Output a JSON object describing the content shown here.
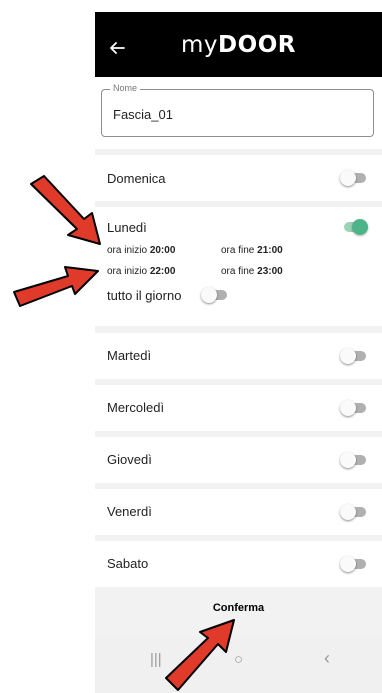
{
  "app": {
    "logo_my": "my",
    "logo_door": "DOOR",
    "back_icon": "arrow-left-icon"
  },
  "name_field": {
    "label": "Nome",
    "value": "Fascia_01"
  },
  "days": [
    {
      "label": "Domenica",
      "enabled": false
    },
    {
      "label": "Lunedì",
      "enabled": true
    },
    {
      "label": "Martedì",
      "enabled": false
    },
    {
      "label": "Mercoledì",
      "enabled": false
    },
    {
      "label": "Giovedì",
      "enabled": false
    },
    {
      "label": "Venerdì",
      "enabled": false
    },
    {
      "label": "Sabato",
      "enabled": false
    }
  ],
  "monday_slots": [
    {
      "start_label": "ora inizio",
      "start": "20:00",
      "end_label": "ora fine",
      "end": "21:00"
    },
    {
      "start_label": "ora inizio",
      "start": "22:00",
      "end_label": "ora fine",
      "end": "23:00"
    }
  ],
  "all_day": {
    "label": "tutto il giorno",
    "enabled": false
  },
  "confirm_button": "Conferma",
  "navbar": {
    "recents": "|||",
    "home": "○",
    "back": "‹"
  },
  "colors": {
    "toggle_on": "#4db389",
    "toggle_off": "#b0b0b0",
    "annotation_arrow": "#e03a2a"
  }
}
